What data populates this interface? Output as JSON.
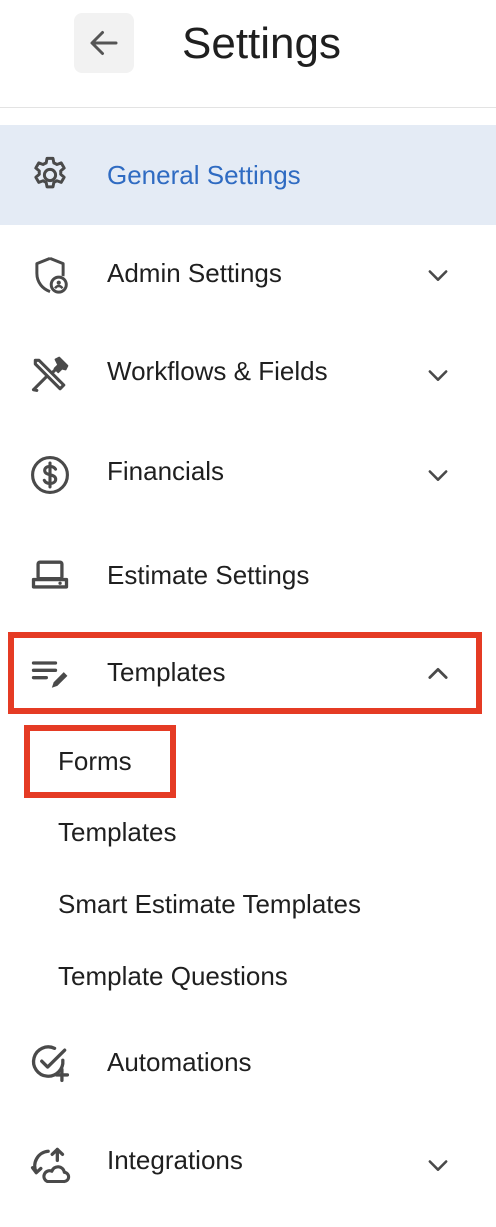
{
  "header": {
    "title": "Settings",
    "back_icon": "arrow-left-icon"
  },
  "colors": {
    "accent": "#2f6bc2",
    "active_bg": "#e4ebf5",
    "highlight": "#e53b24",
    "text": "#1f1f1f",
    "icon": "#4a4a4a"
  },
  "nav": {
    "items": [
      {
        "label": "General Settings",
        "icon": "gear-icon",
        "active": true,
        "expandable": false
      },
      {
        "label": "Admin Settings",
        "icon": "shield-user-icon",
        "active": false,
        "expandable": true,
        "expanded": false
      },
      {
        "label": "Workflows & Fields",
        "icon": "tools-icon",
        "active": false,
        "expandable": true,
        "expanded": false
      },
      {
        "label": "Financials",
        "icon": "dollar-circle-icon",
        "active": false,
        "expandable": true,
        "expanded": false
      },
      {
        "label": "Estimate Settings",
        "icon": "laptop-icon",
        "active": false,
        "expandable": false
      },
      {
        "label": "Templates",
        "icon": "edit-list-icon",
        "active": false,
        "expandable": true,
        "expanded": true,
        "highlighted": true
      },
      {
        "label": "Automations",
        "icon": "check-plus-icon",
        "active": false,
        "expandable": false
      },
      {
        "label": "Integrations",
        "icon": "sync-cloud-icon",
        "active": false,
        "expandable": true,
        "expanded": false
      }
    ],
    "templates_sub": [
      {
        "label": "Forms",
        "highlighted": true
      },
      {
        "label": "Templates"
      },
      {
        "label": "Smart Estimate Templates"
      },
      {
        "label": "Template Questions"
      }
    ]
  }
}
